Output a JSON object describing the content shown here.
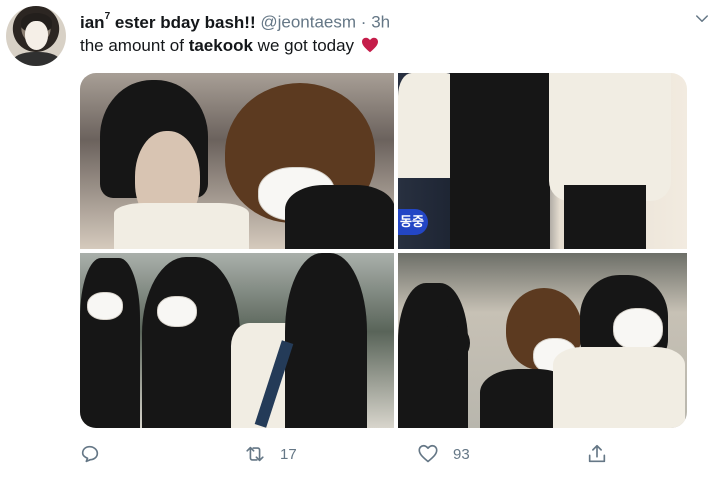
{
  "tweet": {
    "avatar_icon": "user-avatar",
    "display_name": "ian",
    "display_name_superscript": "7",
    "display_name_suffix": " ester bday bash!!",
    "handle": "@jeontaesm",
    "dot": "·",
    "time": "3h",
    "text_before": "the amount of ",
    "text_bold": "taekook",
    "text_after": " we got today",
    "heart_icon": "heart-icon",
    "more_icon": "chevron-down-icon"
  },
  "media": {
    "photos": [
      {
        "label": "photo-1",
        "banner": ""
      },
      {
        "label": "photo-2",
        "banner": "동중"
      },
      {
        "label": "photo-3",
        "banner": ""
      },
      {
        "label": "photo-4",
        "banner": ""
      }
    ]
  },
  "actions": {
    "reply_icon": "reply-icon",
    "retweet_icon": "retweet-icon",
    "retweet_count": "17",
    "like_icon": "heart-outline-icon",
    "like_count": "93",
    "share_icon": "share-icon"
  },
  "colors": {
    "text": "#14171a",
    "muted": "#657786",
    "heart": "#c51d4a",
    "border": "#e6ecf0"
  }
}
